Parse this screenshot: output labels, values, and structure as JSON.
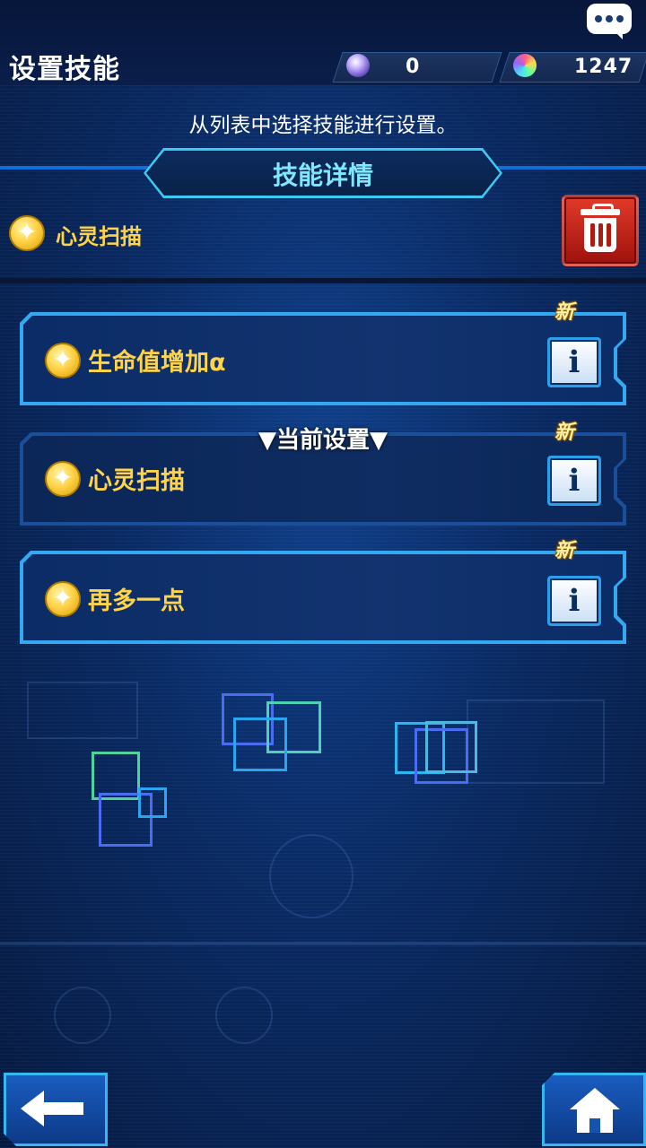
{
  "header": {
    "title": "设置技能",
    "currency_a_value": "0",
    "currency_b_value": "1247"
  },
  "instruction": "从列表中选择技能进行设置。",
  "detail_banner": "技能详情",
  "selected_skill": {
    "name": "心灵扫描"
  },
  "current_setting_label": "▼当前设置▼",
  "skills": [
    {
      "name": "生命值增加α",
      "badge": "新",
      "info_label": "i"
    },
    {
      "name": "心灵扫描",
      "badge": "新",
      "info_label": "i"
    },
    {
      "name": "再多一点",
      "badge": "新",
      "info_label": "i"
    }
  ],
  "colors": {
    "accent": "#34a8f0",
    "gold": "#ffd34a",
    "delete_red": "#d42a1e"
  },
  "icons": {
    "chat": "chat-bubble-icon",
    "currency_a": "orb-gem-icon",
    "currency_b": "rainbow-gem-icon",
    "skill": "star-coin-icon",
    "delete": "trash-icon",
    "info": "info-icon",
    "back": "back-arrow-icon",
    "home": "home-icon"
  }
}
